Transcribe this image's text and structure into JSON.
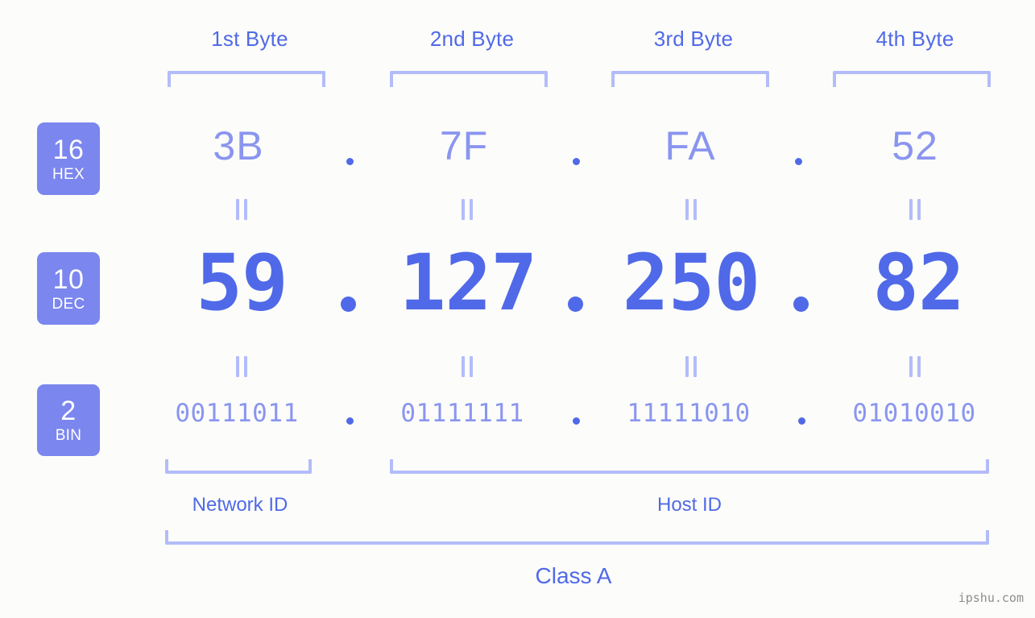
{
  "page": {
    "ip_decimal": "59.127.250.82",
    "ip_class": "Class A",
    "watermark": "ipshu.com",
    "background_color": "#fcfdfa",
    "accent_color": "#5069e8",
    "accent_light_color": "#8a95f0",
    "bracket_color": "#b3bcfa",
    "badge_color": "#7b86ee",
    "separator": "."
  },
  "byte_headers": [
    {
      "label": "1st Byte"
    },
    {
      "label": "2nd Byte"
    },
    {
      "label": "3rd Byte"
    },
    {
      "label": "4th Byte"
    }
  ],
  "bases": [
    {
      "number": "16",
      "name": "HEX"
    },
    {
      "number": "10",
      "name": "DEC"
    },
    {
      "number": "2",
      "name": "BIN"
    }
  ],
  "rows": {
    "hex": {
      "base_number": "16",
      "base_name": "HEX",
      "octets": [
        "3B",
        "7F",
        "FA",
        "52"
      ]
    },
    "dec": {
      "base_number": "10",
      "base_name": "DEC",
      "octets": [
        "59",
        "127",
        "250",
        "82"
      ]
    },
    "bin": {
      "base_number": "2",
      "base_name": "BIN",
      "octets": [
        "00111011",
        "01111111",
        "11111010",
        "01010010"
      ]
    }
  },
  "equivalence_marks": {
    "symbol": "=",
    "count_per_gap": 4,
    "gaps": 2
  },
  "id_sections": [
    {
      "label": "Network ID",
      "bytes": "1"
    },
    {
      "label": "Host ID",
      "bytes": "2-4"
    }
  ],
  "class_section": {
    "label": "Class A"
  }
}
